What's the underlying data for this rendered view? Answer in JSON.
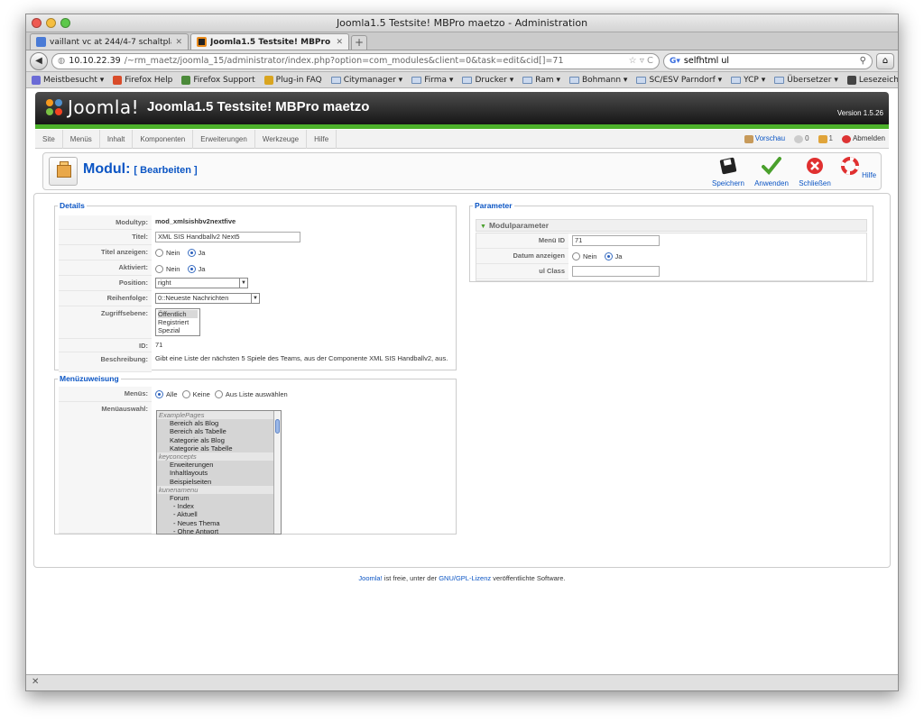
{
  "browser": {
    "window_title": "Joomla1.5 Testsite! MBPro maetzo - Administration",
    "tabs": [
      {
        "label": "vaillant vc at 244/4-7 schaltpla..."
      },
      {
        "label": "Joomla1.5 Testsite! MBPro maet..."
      }
    ],
    "url_host": "10.10.22.39",
    "url_path": "/~rm_maetz/joomla_15/administrator/index.php?option=com_modules&client=0&task=edit&cid[]=71",
    "search_text": "selfhtml ul",
    "bookmarks": [
      "Meistbesucht ▾",
      "Firefox Help",
      "Firefox Support",
      "Plug-in FAQ",
      "Citymanager ▾",
      "Firma ▾",
      "Drucker ▾",
      "Ram ▾",
      "Bohmann ▾",
      "SC/ESV Parndorf ▾",
      "YCP ▾",
      "Übersetzer ▾"
    ],
    "bookmarks_right": "Lesezeichen ▾",
    "status_text": "✕"
  },
  "joomla": {
    "logo_text": "Joomla!",
    "site_title": "Joomla1.5 Testsite! MBPro maetzo",
    "version": "Version 1.5.26",
    "menu": [
      "Site",
      "Menüs",
      "Inhalt",
      "Komponenten",
      "Erweiterungen",
      "Werkzeuge",
      "Hilfe"
    ],
    "status": {
      "preview": "Vorschau",
      "messages": "0",
      "users": "1",
      "logout": "Abmelden"
    },
    "heading": "Modul:",
    "heading_sub": "[ Bearbeiten ]",
    "toolbar": [
      "Speichern",
      "Anwenden",
      "Schließen",
      "Hilfe"
    ],
    "details": {
      "legend": "Details",
      "modultyp_label": "Modultyp:",
      "modultyp_value": "mod_xmlsishbv2nextfive",
      "titel_label": "Titel:",
      "titel_value": "XML SIS Handballv2 Next5",
      "titel_anzeigen_label": "Titel anzeigen:",
      "aktiviert_label": "Aktiviert:",
      "nein": "Nein",
      "ja": "Ja",
      "position_label": "Position:",
      "position_value": "right",
      "reihenfolge_label": "Reihenfolge:",
      "reihenfolge_value": "0::Neueste Nachrichten",
      "zugriff_label": "Zugriffsebene:",
      "zugriff_options": [
        "Öffentlich",
        "Registriert",
        "Spezial"
      ],
      "id_label": "ID:",
      "id_value": "71",
      "beschreibung_label": "Beschreibung:",
      "beschreibung_value": "Gibt eine Liste der nächsten 5 Spiele des Teams, aus der Componente XML SIS Handballv2, aus."
    },
    "menuzuweisung": {
      "legend": "Menüzuweisung",
      "menus_label": "Menüs:",
      "alle": "Alle",
      "keine": "Keine",
      "aus_liste": "Aus Liste auswählen",
      "menuauswahl_label": "Menüauswahl:",
      "items": [
        {
          "type": "grp",
          "text": "ExamplePages"
        },
        {
          "type": "opt",
          "text": "Bereich als Blog"
        },
        {
          "type": "opt",
          "text": "Bereich als Tabelle"
        },
        {
          "type": "opt",
          "text": "Kategorie als Blog"
        },
        {
          "type": "opt",
          "text": "Kategorie als Tabelle"
        },
        {
          "type": "grp",
          "text": "keyconcepts"
        },
        {
          "type": "opt",
          "text": "Erweiterungen"
        },
        {
          "type": "opt",
          "text": "Inhaltlayouts"
        },
        {
          "type": "opt",
          "text": "Beispielseiten"
        },
        {
          "type": "grp",
          "text": "kunenamenu"
        },
        {
          "type": "opt",
          "text": "Forum"
        },
        {
          "type": "opt2",
          "text": "- Index"
        },
        {
          "type": "opt2",
          "text": "- Aktuell"
        },
        {
          "type": "opt2",
          "text": "- Neues Thema"
        },
        {
          "type": "opt2",
          "text": "- Ohne Antwort"
        }
      ]
    },
    "parameter": {
      "legend": "Parameter",
      "section": "Modulparameter",
      "menu_id_label": "Menü ID",
      "menu_id_value": "71",
      "datum_label": "Datum anzeigen",
      "nein": "Nein",
      "ja": "Ja",
      "ulclass_label": "ul Class",
      "ulclass_value": ""
    },
    "footer": {
      "joomla_link": "Joomla!",
      "text1": " ist freie, unter der ",
      "gpl_link": "GNU/GPL-Lizenz",
      "text2": " veröffentlichte Software."
    }
  }
}
